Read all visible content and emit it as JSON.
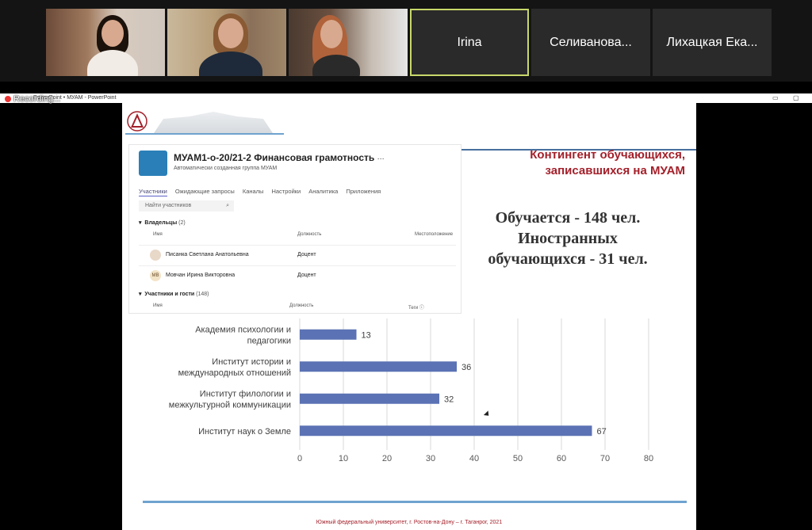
{
  "participants": [
    {
      "type": "video"
    },
    {
      "type": "video"
    },
    {
      "type": "video"
    },
    {
      "type": "name",
      "name": "Irina",
      "active": true
    },
    {
      "type": "name",
      "name": "Селиванова...",
      "active": false
    },
    {
      "type": "name",
      "name": "Лихацкая Ека...",
      "active": false
    }
  ],
  "app": {
    "window_title": "... - PowerPoint  •  МУАМ - PowerPoint",
    "recording_label": "Recording..."
  },
  "teams": {
    "group_title": "МУАМ1-о-20/21-2 Финансовая грамотность",
    "more": "···",
    "subtitle": "Автоматически созданная группа МУАМ",
    "tabs": [
      "Участники",
      "Ожидающие запросы",
      "Каналы",
      "Настройки",
      "Аналитика",
      "Приложения"
    ],
    "search_placeholder": "Найти участников",
    "owners": {
      "label": "Владельцы",
      "count": "(2)",
      "columns": [
        "Имя",
        "Должность",
        "Местоположение"
      ],
      "rows": [
        {
          "initials": "",
          "name": "Писанка Светлана Анатольевна",
          "role": "Доцент"
        },
        {
          "initials": "МВ",
          "name": "Мовчан Ирина Викторовна",
          "role": "Доцент"
        }
      ]
    },
    "members": {
      "label": "Участники и гости",
      "count": "(148)",
      "columns": [
        "Имя",
        "Должность",
        "Теги"
      ]
    }
  },
  "slide": {
    "heading_line1": "Контингент обучающихся,",
    "heading_line2": "записавшихся на МУАМ",
    "stat_line1": "Обучается - 148 чел.",
    "stat_line2": "Иностранных",
    "stat_line3": "обучающихся - 31 чел.",
    "footer": "Южный федеральный университет, г. Ростов-на-Дону – г. Таганрог, 2021"
  },
  "chart_data": {
    "type": "bar",
    "orientation": "horizontal",
    "categories": [
      [
        "Академия психологии и",
        "педагогики"
      ],
      [
        "Институт истории и",
        "международных отношений"
      ],
      [
        "Институт филологии и",
        "межкультурной коммуникации"
      ],
      [
        "Институт  наук о Земле"
      ]
    ],
    "values": [
      13,
      36,
      32,
      67
    ],
    "xlim": [
      0,
      80
    ],
    "xticks": [
      0,
      10,
      20,
      30,
      40,
      50,
      60,
      70,
      80
    ],
    "grid": true,
    "bar_color": "#5b72b4"
  }
}
